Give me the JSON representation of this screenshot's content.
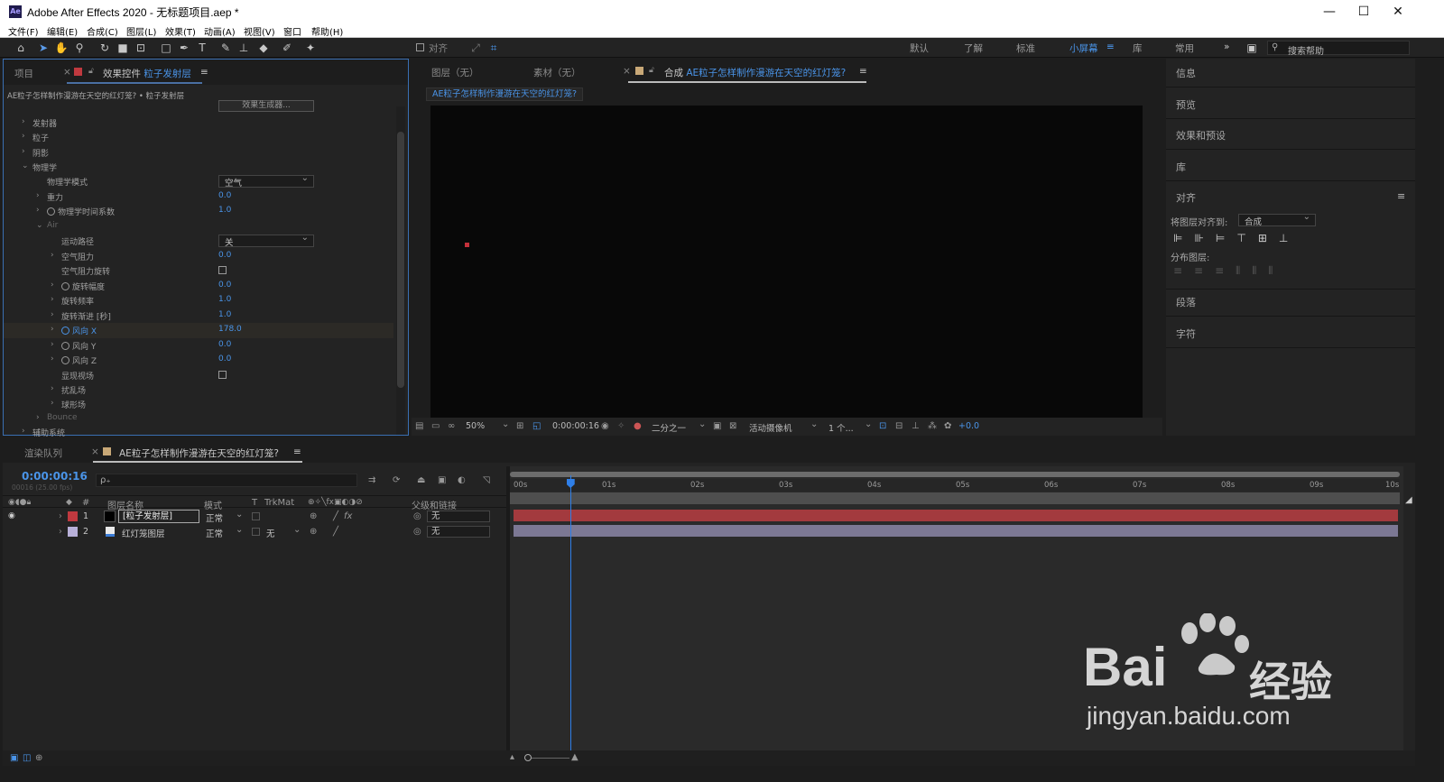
{
  "window": {
    "title": "Adobe After Effects 2020 - 无标题项目.aep *",
    "app_icon": "Ae",
    "controls": [
      "—",
      "☐",
      "✕"
    ]
  },
  "menu": [
    "文件(F)",
    "编辑(E)",
    "合成(C)",
    "图层(L)",
    "效果(T)",
    "动画(A)",
    "视图(V)",
    "窗口",
    "帮助(H)"
  ],
  "toolbar": {
    "snap_label": "对齐",
    "workspaces": [
      "默认",
      "了解",
      "标准",
      "小屏幕",
      "库",
      "常用"
    ],
    "active_workspace": "小屏幕",
    "more": "»",
    "search_placeholder": "搜索帮助"
  },
  "left_panel": {
    "tab_project": "项目",
    "tab_effects_prefix": "效果控件",
    "tab_effects_layer": "粒子发射层",
    "breadcrumb": "AE粒子怎样制作漫游在天空的红灯笼? • 粒子发射层",
    "effect_button": "效果生成器...",
    "rows": [
      {
        "label": "发射器",
        "value": ""
      },
      {
        "label": "粒子",
        "value": ""
      },
      {
        "label": "阴影",
        "value": ""
      },
      {
        "label": "物理学",
        "value": ""
      },
      {
        "label": "物理学模式",
        "value": "空气"
      },
      {
        "label": "重力",
        "value": "0.0"
      },
      {
        "label": "物理学时间系数",
        "value": "1.0"
      },
      {
        "label": "Air",
        "value": ""
      },
      {
        "label": "运动路径",
        "value": "关"
      },
      {
        "label": "空气阻力",
        "value": "0.0"
      },
      {
        "label": "空气阻力旋转",
        "value": ""
      },
      {
        "label": "旋转幅度",
        "value": "0.0"
      },
      {
        "label": "旋转频率",
        "value": "1.0"
      },
      {
        "label": "旋转渐进 [秒]",
        "value": "1.0"
      },
      {
        "label": "风向 X",
        "value": "178.0"
      },
      {
        "label": "风向 Y",
        "value": "0.0"
      },
      {
        "label": "风向 Z",
        "value": "0.0"
      },
      {
        "label": "显现视场",
        "value": ""
      },
      {
        "label": "扰乱场",
        "value": ""
      },
      {
        "label": "球形场",
        "value": ""
      },
      {
        "label": "Bounce",
        "value": ""
      },
      {
        "label": "辅助系统",
        "value": ""
      }
    ]
  },
  "center_panel": {
    "tab_layer": "图层（无）",
    "tab_footage": "素材（无）",
    "tab_comp_prefix": "合成",
    "tab_comp_name": "AE粒子怎样制作漫游在天空的红灯笼?",
    "comp_chip": "AE粒子怎样制作漫游在天空的红灯笼?",
    "viewer_bar": {
      "zoom": "50%",
      "timecode": "0:00:00:16",
      "resolution": "二分之一",
      "camera": "活动摄像机",
      "views": "1 个...",
      "exposure": "+0.0"
    }
  },
  "right_panel": {
    "items": [
      "信息",
      "预览",
      "效果和预设",
      "库"
    ],
    "align_title": "对齐",
    "align_to_label": "将图层对齐到:",
    "align_to_value": "合成",
    "distribute_label": "分布图层:",
    "bottom_items": [
      "段落",
      "字符"
    ]
  },
  "timeline": {
    "tab_render": "渲染队列",
    "tab_comp": "AE粒子怎样制作漫游在天空的红灯笼?",
    "timecode": "0:00:00:16",
    "frame_info": "00016 (25.00 fps)",
    "search_placeholder": "ρ₊",
    "columns": {
      "layer_name": "图层名称",
      "mode": "模式",
      "t": "T",
      "trkmat": "TrkMat",
      "parent": "父级和链接"
    },
    "ruler": [
      "00s",
      "01s",
      "02s",
      "03s",
      "04s",
      "05s",
      "06s",
      "07s",
      "08s",
      "09s",
      "10s"
    ],
    "playhead_time_s": 0.64,
    "layers": [
      {
        "num": "1",
        "name": "[粒子发射层]",
        "mode": "正常",
        "trkmat": "",
        "parent": "无",
        "color": "#c0393f",
        "bar_color": "#a33a3e"
      },
      {
        "num": "2",
        "name": "红灯笼图层",
        "mode": "正常",
        "trkmat": "无",
        "parent": "无",
        "color": "#b8b0d8",
        "bar_color": "#7c7894"
      }
    ]
  },
  "watermark": {
    "brand": "Bai",
    "brand_cn": "经验",
    "url": "jingyan.baidu.com"
  }
}
